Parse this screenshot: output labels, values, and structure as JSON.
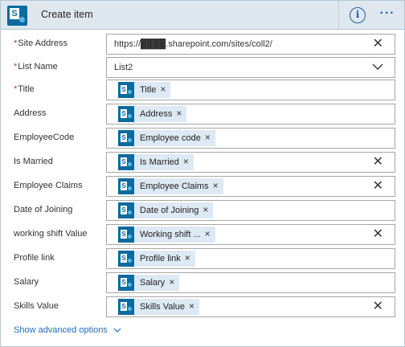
{
  "header": {
    "title": "Create item",
    "info_icon": "info-icon",
    "more_icon": "more-options-icon",
    "info_glyph": "i",
    "more_glyph": "···",
    "logo_letter": "S"
  },
  "colors": {
    "header_bg": "#dfe7ef",
    "accent": "#1f5fa8",
    "sharepoint": "#0b6a9f",
    "token_bg": "#dde9f4",
    "required": "#d13438"
  },
  "fields": [
    {
      "label": "Site Address",
      "required": true,
      "value": "https://████.sharepoint.com/sites/coll2/",
      "value_visible": "https://",
      "value_rest": ".sharepoint.com/sites/coll2/",
      "action": "clear"
    },
    {
      "label": "List Name",
      "required": true,
      "value": "List2",
      "action": "dropdown"
    },
    {
      "label": "Title",
      "required": true,
      "token": "Title",
      "action": ""
    },
    {
      "label": "Address",
      "required": false,
      "token": "Address",
      "action": ""
    },
    {
      "label": "EmployeeCode",
      "required": false,
      "token": "Employee code",
      "action": ""
    },
    {
      "label": "Is Married",
      "required": false,
      "token": "Is Married",
      "action": "clear"
    },
    {
      "label": "Employee Claims",
      "required": false,
      "token": "Employee Claims",
      "action": "clear"
    },
    {
      "label": "Date of Joining",
      "required": false,
      "token": "Date of Joining",
      "action": ""
    },
    {
      "label": "working shift Value",
      "required": false,
      "token": "Working shift ...",
      "action": "clear"
    },
    {
      "label": "Profile link",
      "required": false,
      "token": "Profile link",
      "action": ""
    },
    {
      "label": "Salary",
      "required": false,
      "token": "Salary",
      "action": ""
    },
    {
      "label": "Skills Value",
      "required": false,
      "token": "Skills Value",
      "action": "clear"
    }
  ],
  "glyphs": {
    "required": "*",
    "clear": "✕",
    "token_remove": "×"
  },
  "footer": {
    "advanced_label": "Show advanced options",
    "advanced_icon": "chevron-down-icon"
  }
}
